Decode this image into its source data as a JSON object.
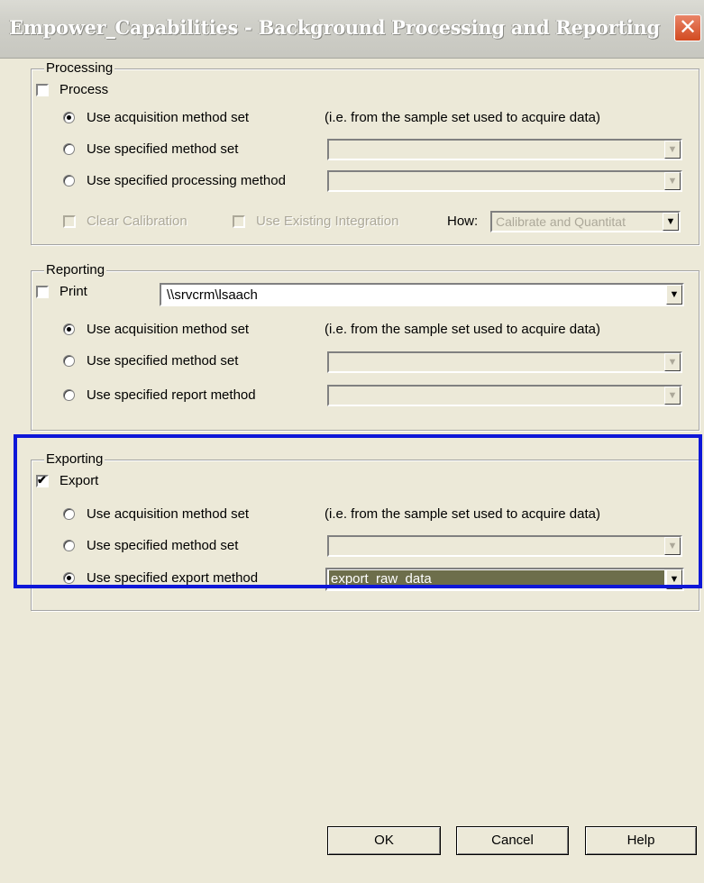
{
  "window": {
    "title": "Empower_Capabilities - Background Processing and Reporting",
    "close_glyph": "✕"
  },
  "processing": {
    "group_label": "Processing",
    "process_label": "Process",
    "process_checked": false,
    "opt_acq": "Use acquisition method set",
    "opt_acq_note": "(i.e. from the sample set used to acquire data)",
    "opt_method_set": "Use specified method set",
    "opt_proc_method": "Use specified processing method",
    "selected": "acquisition",
    "clear_calibration": "Clear Calibration",
    "use_existing_integration": "Use Existing Integration",
    "how_label": "How:",
    "how_value": "Calibrate and Quantitat"
  },
  "reporting": {
    "group_label": "Reporting",
    "print_label": "Print",
    "print_checked": false,
    "printer_value": "\\\\srvcrm\\lsaach",
    "opt_acq": "Use acquisition method set",
    "opt_acq_note": "(i.e. from the sample set used to acquire data)",
    "opt_method_set": "Use specified method set",
    "opt_report_method": "Use specified report method",
    "selected": "acquisition"
  },
  "exporting": {
    "group_label": "Exporting",
    "export_label": "Export",
    "export_checked": true,
    "check_glyph": "✔",
    "opt_acq": "Use acquisition method set",
    "opt_acq_note": "(i.e. from the sample set used to acquire data)",
    "opt_method_set": "Use specified method set",
    "opt_export_method": "Use specified export method",
    "export_method_value": "export_raw_data",
    "selected": "export_method"
  },
  "buttons": {
    "ok": "OK",
    "cancel": "Cancel",
    "help": "Help"
  },
  "icons": {
    "dropdown": "▼"
  },
  "colors": {
    "highlight": "#0e17d8",
    "selection": "#6d6e4b"
  }
}
